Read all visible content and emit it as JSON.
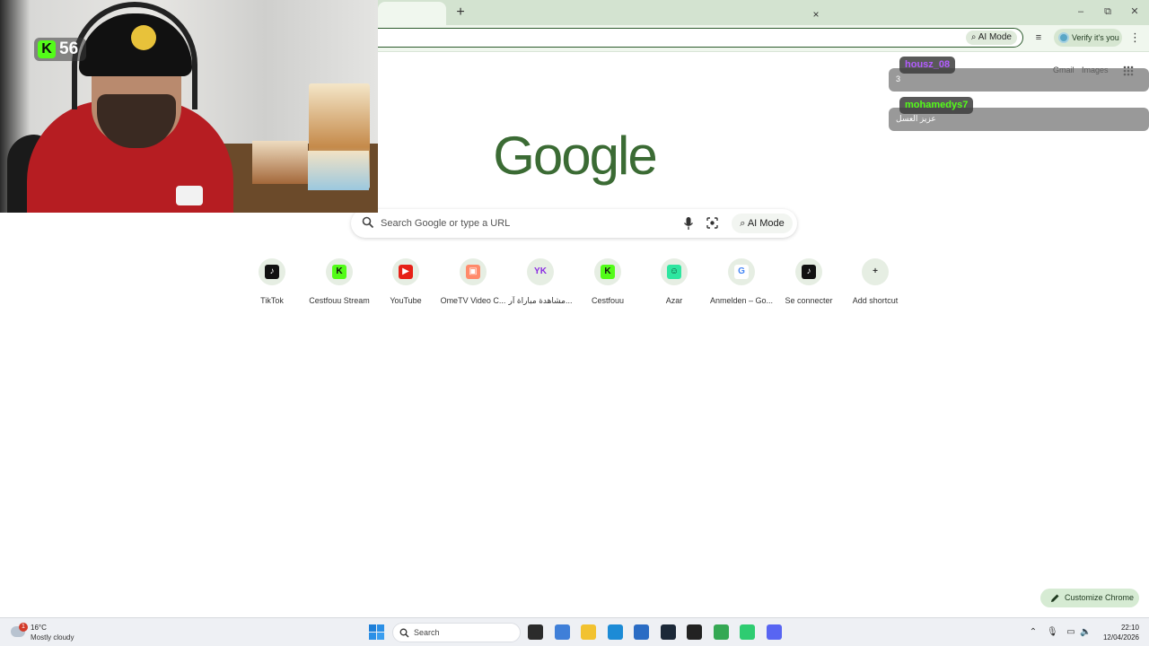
{
  "browser": {
    "tab_close": "×",
    "new_tab": "+",
    "window_controls": {
      "minimize": "–",
      "restore": "⧉",
      "close": "✕"
    },
    "omnibox_ai_mode": "AI Mode",
    "verify_label": "Verify it's you",
    "menu": "⋮"
  },
  "stream": {
    "viewer_icon": "K",
    "viewer_count": "56"
  },
  "chat": [
    {
      "user": "housz_08",
      "user_color": "#b25cff",
      "text": "3"
    },
    {
      "user": "mohamedys7",
      "user_color": "#53fc18",
      "text": "عزيز العسل"
    }
  ],
  "ntp": {
    "gmail": "Gmail",
    "images": "Images",
    "logo_text": "Google",
    "search_placeholder": "Search Google or type a URL",
    "ai_mode_label": "AI Mode",
    "customize_label": "Customize Chrome",
    "shortcuts": [
      {
        "label": "TikTok",
        "icon": "tiktok-icon",
        "glyph": "♪",
        "bg": "#111111",
        "fg": "#ffffff"
      },
      {
        "label": "Cestfouu Stream",
        "icon": "kick-icon",
        "glyph": "K",
        "bg": "#53fc18",
        "fg": "#111111"
      },
      {
        "label": "YouTube",
        "icon": "youtube-icon",
        "glyph": "▶",
        "bg": "#e62117",
        "fg": "#ffffff"
      },
      {
        "label": "OmeTV Video C...",
        "icon": "ometv-icon",
        "glyph": "▣",
        "bg": "#ff8a6a",
        "fg": "#ffffff"
      },
      {
        "label": "مشاهدة مباراة آر...",
        "icon": "yk-icon",
        "glyph": "YK",
        "bg": "#e6eee3",
        "fg": "#8a2be2"
      },
      {
        "label": "Cestfouu",
        "icon": "kick-icon",
        "glyph": "K",
        "bg": "#53fc18",
        "fg": "#111111"
      },
      {
        "label": "Azar",
        "icon": "azar-icon",
        "glyph": "☺",
        "bg": "#2ee6a0",
        "fg": "#0b3d2a"
      },
      {
        "label": "Anmelden – Go...",
        "icon": "google-icon",
        "glyph": "G",
        "bg": "#ffffff",
        "fg": "#4285f4"
      },
      {
        "label": "Se connecter",
        "icon": "tiktok-icon",
        "glyph": "♪",
        "bg": "#111111",
        "fg": "#ffffff"
      },
      {
        "label": "Add shortcut",
        "icon": "plus-icon",
        "glyph": "+",
        "bg": "#e6eee3",
        "fg": "#333333"
      }
    ]
  },
  "taskbar": {
    "weather_alert": "1",
    "weather_temp": "16°C",
    "weather_condition": "Mostly cloudy",
    "search_label": "Search",
    "time": "22:10",
    "date": "12/04/2026",
    "apps": [
      {
        "name": "task-view-icon",
        "color": "#2b2b2b"
      },
      {
        "name": "photos-icon",
        "color": "#3f7fd8"
      },
      {
        "name": "file-explorer-icon",
        "color": "#f2c230"
      },
      {
        "name": "edge-icon",
        "color": "#1c8bd6"
      },
      {
        "name": "store-icon",
        "color": "#2a6cc4"
      },
      {
        "name": "steam-icon",
        "color": "#1b2838"
      },
      {
        "name": "media-player-icon",
        "color": "#222222"
      },
      {
        "name": "chrome-icon",
        "color": "#34a853"
      },
      {
        "name": "android-icon",
        "color": "#2ecc71"
      },
      {
        "name": "discord-icon",
        "color": "#5865f2"
      }
    ]
  }
}
